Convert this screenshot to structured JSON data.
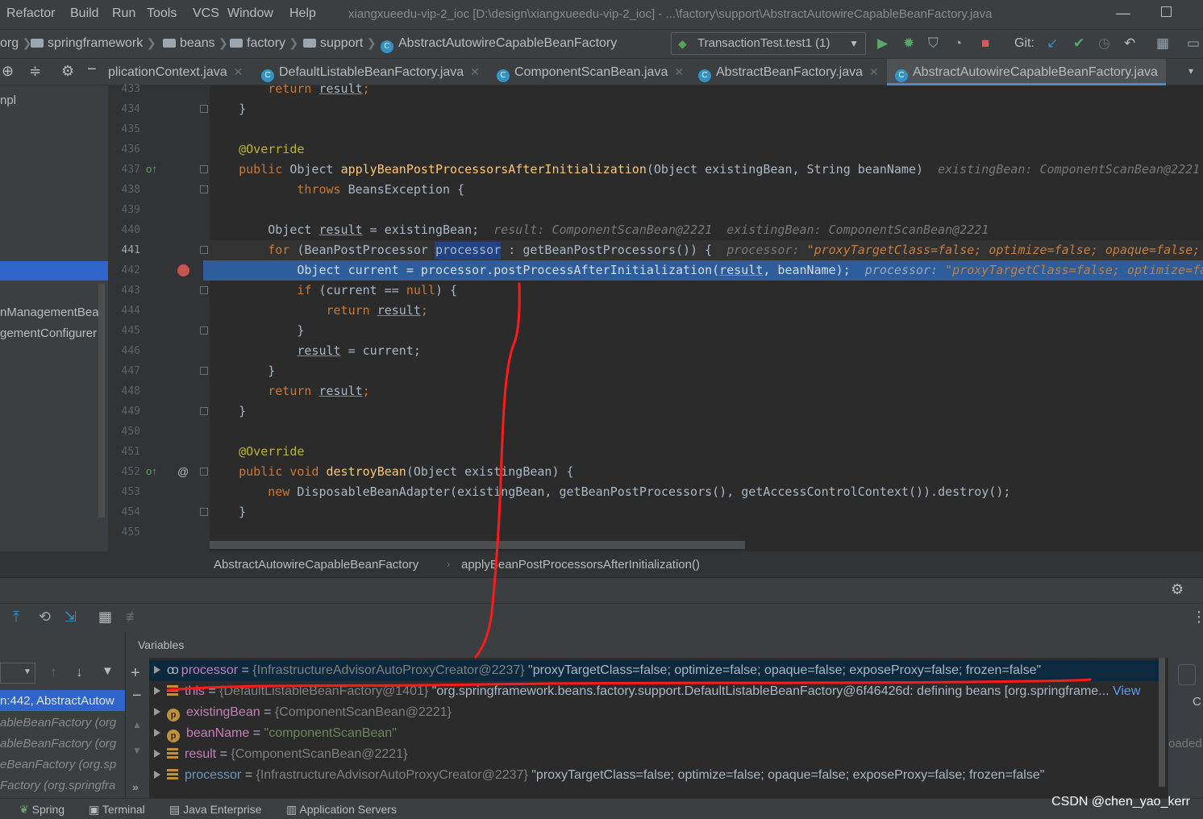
{
  "menu": {
    "items": [
      "Refactor",
      "Build",
      "Run",
      "Tools",
      "VCS",
      "Window",
      "Help"
    ],
    "window_title": "xiangxueedu-vip-2_ioc [D:\\design\\xiangxueedu-vip-2_ioc] - ...\\factory\\support\\AbstractAutowireCapableBeanFactory.java"
  },
  "breadcrumb": {
    "items": [
      "org",
      "springframework",
      "beans",
      "factory",
      "support",
      "AbstractAutowireCapableBeanFactory"
    ]
  },
  "run_config": {
    "label": "TransactionTest.test1 (1)"
  },
  "git": {
    "label": "Git:"
  },
  "tabs": [
    {
      "label": "plicationContext.java",
      "active": false
    },
    {
      "label": "DefaultListableBeanFactory.java",
      "active": false
    },
    {
      "label": "ComponentScanBean.java",
      "active": false
    },
    {
      "label": "AbstractBeanFactory.java",
      "active": false
    },
    {
      "label": "AbstractAutowireCapableBeanFactory.java",
      "active": true
    }
  ],
  "project_panel": {
    "items": [
      "npl",
      "nManagementBean",
      "gementConfigurer"
    ]
  },
  "editor": {
    "line_numbers": [
      "433",
      "434",
      "435",
      "436",
      "437",
      "438",
      "439",
      "440",
      "441",
      "442",
      "443",
      "444",
      "445",
      "446",
      "447",
      "448",
      "449",
      "450",
      "451",
      "452",
      "453",
      "454",
      "455"
    ],
    "lines": {
      "l433_ret": "return",
      "l433_res": "result",
      "l434": "}",
      "l436": "@Override",
      "l437_pub": "public",
      "l437_type": " Object ",
      "l437_fn": "applyBeanPostProcessorsAfterInitialization",
      "l437_args": "(Object existingBean, String beanName)",
      "l437_hint": "existingBean: ComponentScanBean@2221",
      "l438_throws": "throws",
      "l438_rest": " BeansException {",
      "l440_obj": "Object ",
      "l440_res": "result",
      "l440_rest": " = existingBean;",
      "l440_hint1": "result: ComponentScanBean@2221",
      "l440_hint2": "existingBean: ComponentScanBean@2221",
      "l441_for": "for",
      "l441_a": " (BeanPostProcessor ",
      "l441_proc": "processor",
      "l441_b": " : getBeanPostProcessors()) {",
      "l441_hint_k": "processor: ",
      "l441_hint_v": "\"proxyTargetClass=false; optimize=false; opaque=false;",
      "l442_a": "Object current = processor.postProcessAfterInitialization(",
      "l442_res": "result",
      "l442_b": ", beanName);",
      "l442_hint_k": "processor: ",
      "l442_hint_v": "\"proxyTargetClass=false; optimize=fa",
      "l443_if": "if",
      "l443_a": " (current == ",
      "l443_null": "null",
      "l443_b": ") {",
      "l444_ret": "return",
      "l444_res": "result",
      "l445": "}",
      "l446_res": "result",
      "l446_rest": " = current;",
      "l447": "}",
      "l448_ret": "return",
      "l448_res": "result",
      "l449": "}",
      "l451": "@Override",
      "l452_pub": "public",
      "l452_void": " void ",
      "l452_fn": "destroyBean",
      "l452_args": "(Object existingBean) {",
      "l453_new": "new",
      "l453_rest": " DisposableBeanAdapter(existingBean, getBeanPostProcessors(), getAccessControlContext()).destroy();",
      "l454": "}"
    }
  },
  "editor_breadcrumb": {
    "class": "AbstractAutowireCapableBeanFactory",
    "method": "applyBeanPostProcessorsAfterInitialization()"
  },
  "debug": {
    "variables_title": "Variables",
    "frames": [
      "n:442, AbstractAutow",
      "ableBeanFactory (org",
      "ableBeanFactory (org",
      "eBeanFactory (org.sp",
      "Factory (org.springfra"
    ],
    "variables": [
      {
        "name": "processor",
        "type": "{InfrastructureAdvisorAutoProxyCreator@2237}",
        "value": "\"proxyTargetClass=false; optimize=false; opaque=false; exposeProxy=false; frozen=false\"",
        "icon": "watch"
      },
      {
        "name": "this",
        "type": "{DefaultListableBeanFactory@1401}",
        "value": "\"org.springframework.beans.factory.support.DefaultListableBeanFactory@6f46426d: defining beans [org.springframe...",
        "view": "View",
        "icon": "list"
      },
      {
        "name": "existingBean",
        "type": "{ComponentScanBean@2221}",
        "value": "",
        "icon": "p"
      },
      {
        "name": "beanName",
        "type": "",
        "value": "\"componentScanBean\"",
        "icon": "p"
      },
      {
        "name": "result",
        "type": "{ComponentScanBean@2221}",
        "value": "",
        "icon": "list"
      },
      {
        "name": "processor",
        "type": "{InfrastructureAdvisorAutoProxyCreator@2237}",
        "value": "\"proxyTargetClass=false; optimize=false; opaque=false; exposeProxy=false; frozen=false\"",
        "icon": "list"
      }
    ],
    "right_text": [
      "C",
      "oaded"
    ]
  },
  "statusbar": {
    "items": [
      "Spring",
      "Terminal",
      "Java Enterprise",
      "Application Servers"
    ],
    "watermark": "CSDN @chen_yao_kerr"
  },
  "colors": {
    "annotation_red": "#ff1a1a",
    "exec_line": "#2d5d9b",
    "keyword": "#cc7832"
  }
}
